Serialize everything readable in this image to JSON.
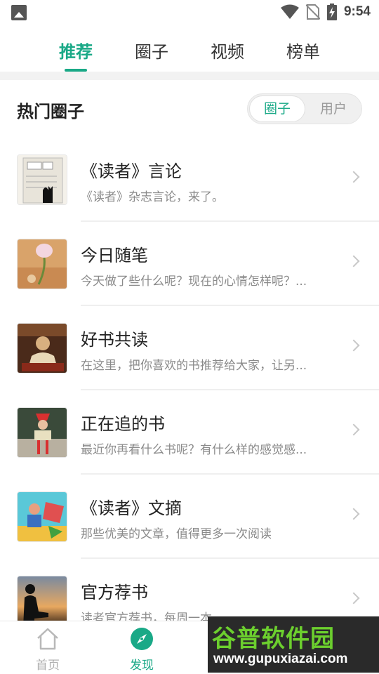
{
  "status_bar": {
    "time": "9:54"
  },
  "top_tabs": [
    {
      "label": "推荐",
      "active": true
    },
    {
      "label": "圈子",
      "active": false
    },
    {
      "label": "视频",
      "active": false
    },
    {
      "label": "榜单",
      "active": false
    }
  ],
  "section": {
    "title": "热门圈子",
    "toggle": {
      "active": "圈子",
      "inactive": "用户"
    }
  },
  "circles": [
    {
      "title": "《读者》言论",
      "subtitle": "《读者》杂志言论，来了。"
    },
    {
      "title": "今日随笔",
      "subtitle": "今天做了些什么呢？现在的心情怎样呢？..."
    },
    {
      "title": "好书共读",
      "subtitle": "在这里，把你喜欢的书推荐给大家，让另..."
    },
    {
      "title": "正在追的书",
      "subtitle": "最近你再看什么书呢？有什么样的感觉感..."
    },
    {
      "title": "《读者》文摘",
      "subtitle": "那些优美的文章，值得更多一次阅读"
    },
    {
      "title": "官方荐书",
      "subtitle": "读者官方荐书，每周一本"
    }
  ],
  "bottom_nav": [
    {
      "label": "首页",
      "icon": "home-icon",
      "active": false
    },
    {
      "label": "发现",
      "icon": "compass-icon",
      "active": true
    }
  ],
  "watermark": {
    "text": "谷普软件园",
    "url": "www.gupuxiazai.com"
  },
  "colors": {
    "accent": "#1aa987"
  }
}
